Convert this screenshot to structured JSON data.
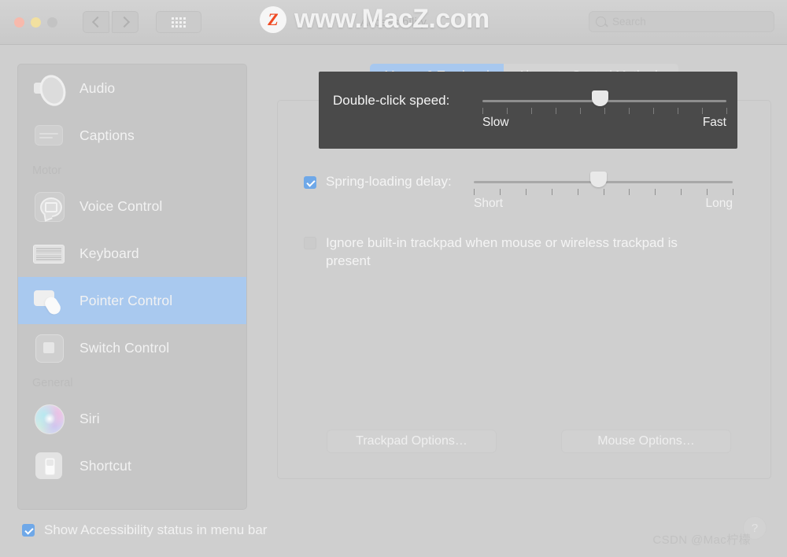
{
  "window": {
    "title": "Accessibility",
    "traffic_lights": [
      "close",
      "minimize",
      "zoom"
    ],
    "back_label": "‹",
    "forward_label": "›",
    "grid_label": "show-all"
  },
  "search": {
    "placeholder": "Search",
    "value": ""
  },
  "watermark": {
    "badge": "Z",
    "site": "www.MacZ.com",
    "credit": "CSDN @Mac柠檬"
  },
  "sidebar": {
    "items": [
      {
        "type": "item",
        "label": "Audio",
        "icon": "speaker-icon",
        "selected": false
      },
      {
        "type": "item",
        "label": "Captions",
        "icon": "captions-icon",
        "selected": false
      },
      {
        "type": "group",
        "label": "Motor"
      },
      {
        "type": "item",
        "label": "Voice Control",
        "icon": "voice-control-icon",
        "selected": false
      },
      {
        "type": "item",
        "label": "Keyboard",
        "icon": "keyboard-icon",
        "selected": false
      },
      {
        "type": "item",
        "label": "Pointer Control",
        "icon": "pointer-control-icon",
        "selected": true
      },
      {
        "type": "item",
        "label": "Switch Control",
        "icon": "switch-control-icon",
        "selected": false
      },
      {
        "type": "group",
        "label": "General"
      },
      {
        "type": "item",
        "label": "Siri",
        "icon": "siri-icon",
        "selected": false
      },
      {
        "type": "item",
        "label": "Shortcut",
        "icon": "shortcut-icon",
        "selected": false
      }
    ]
  },
  "main": {
    "tabs": [
      {
        "label": "Mouse & Trackpad",
        "active": true
      },
      {
        "label": "Alternate Control Methods",
        "active": false
      }
    ],
    "double_click": {
      "label": "Double-click speed:",
      "min_label": "Slow",
      "max_label": "Fast",
      "ticks": 11,
      "value_percent": 48
    },
    "spring_loading": {
      "label": "Spring-loading delay:",
      "checked": true,
      "min_label": "Short",
      "max_label": "Long",
      "ticks": 11,
      "value_percent": 48
    },
    "ignore_trackpad": {
      "label": "Ignore built-in trackpad when mouse or wireless trackpad is present",
      "checked": false
    },
    "buttons": {
      "trackpad_options": "Trackpad Options…",
      "mouse_options": "Mouse Options…"
    }
  },
  "footer": {
    "show_status": {
      "label": "Show Accessibility status in menu bar",
      "checked": true
    },
    "help_label": "?"
  },
  "colors": {
    "accent": "#a8c8ef",
    "checkbox": "#6fa8e8",
    "highlight_box": "#4a4a4a",
    "window_bg": "#cfcfcf",
    "sidebar_bg": "#c6c6c6"
  }
}
